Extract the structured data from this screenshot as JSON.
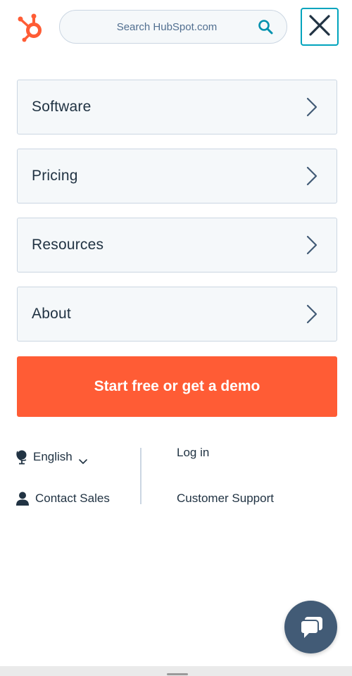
{
  "header": {
    "logo_icon": "hubspot-sprocket-icon",
    "search_placeholder": "Search HubSpot.com",
    "search_icon": "search-icon",
    "close_icon": "close-icon"
  },
  "nav": {
    "items": [
      {
        "label": "Software"
      },
      {
        "label": "Pricing"
      },
      {
        "label": "Resources"
      },
      {
        "label": "About"
      }
    ],
    "chevron_icon": "chevron-right-icon"
  },
  "cta": {
    "label": "Start free or get a demo"
  },
  "footer": {
    "language": "English",
    "contact_sales": "Contact Sales",
    "log_in": "Log in",
    "customer_support": "Customer Support"
  },
  "chat": {
    "icon": "chat-bubble-icon"
  },
  "colors": {
    "brand_orange": "#ff5c35",
    "text_dark": "#213343",
    "border": "#cbd6e2",
    "panel_bg": "#f5f8fa",
    "accent_teal": "#00a4bd",
    "chat_bg": "#425b76"
  }
}
